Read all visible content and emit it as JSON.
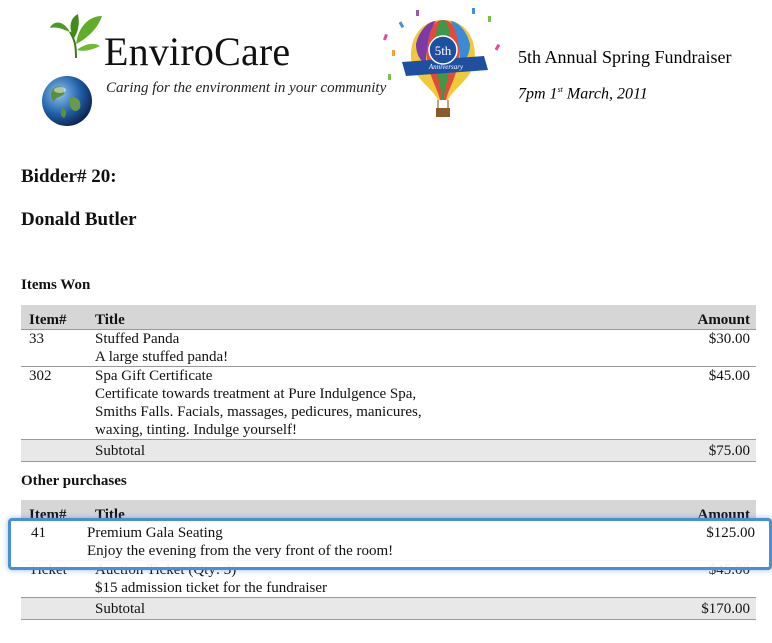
{
  "header": {
    "brand": "EnviroCare",
    "tagline": "Caring for the environment in your community",
    "event_title": "5th Annual Spring Fundraiser",
    "event_date_pre": "7pm 1",
    "event_date_sup": "st",
    "event_date_post": " March, 2011",
    "badge_text": "5th",
    "badge_sub": "Anniversary"
  },
  "bidder": {
    "label": "Bidder# 20:",
    "name": "Donald Butler"
  },
  "items_won": {
    "title": "Items Won",
    "columns": {
      "item": "Item#",
      "title": "Title",
      "amount": "Amount"
    },
    "rows": [
      {
        "num": "33",
        "title": "Stuffed Panda",
        "desc": "A large stuffed panda!",
        "amount": "$30.00"
      },
      {
        "num": "302",
        "title": "Spa Gift Certificate",
        "desc1": "Certificate towards treatment at Pure Indulgence Spa,",
        "desc2": "Smiths Falls. Facials, massages, pedicures, manicures,",
        "desc3": "waxing, tinting. Indulge yourself!",
        "amount": "$45.00"
      }
    ],
    "subtotal_label": "Subtotal",
    "subtotal_value": "$75.00"
  },
  "other_purchases": {
    "title": "Other purchases",
    "columns": {
      "item": "Item#",
      "title": "Title",
      "amount": "Amount"
    },
    "highlight": {
      "num": "41",
      "title": "Premium Gala Seating",
      "desc": "Enjoy the evening from the very front of the room!",
      "amount": "$125.00"
    },
    "rows": [
      {
        "num": "Ticket",
        "title": "Auction Ticket (Qty: 3)",
        "desc": "$15 admission ticket for the fundraiser",
        "amount": "$45.00"
      }
    ],
    "subtotal_label": "Subtotal",
    "subtotal_value": "$170.00"
  },
  "colors": {
    "accent_border": "#4a8fd6",
    "header_bg": "#d6d6d6"
  }
}
